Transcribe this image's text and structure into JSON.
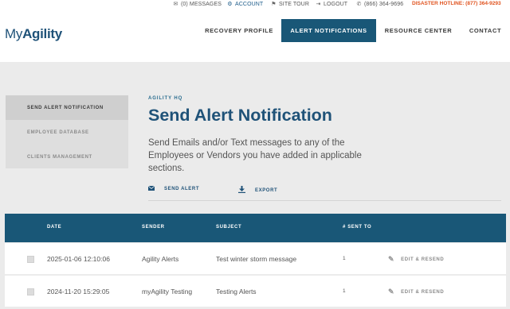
{
  "utility_bar": {
    "messages": "(0) MESSAGES",
    "account": "ACCOUNT",
    "site_tour": "SITE TOUR",
    "logout": "LOGOUT",
    "phone": "(866) 364-9696",
    "hotline": "DISASTER HOTLINE: (877) 364-9293"
  },
  "brand": {
    "logo_my": "My",
    "logo_agility": "Agility"
  },
  "nav": {
    "items": [
      {
        "label": "RECOVERY PROFILE"
      },
      {
        "label": "ALERT NOTIFICATIONS"
      },
      {
        "label": "RESOURCE CENTER"
      },
      {
        "label": "CONTACT"
      }
    ]
  },
  "sidebar": {
    "items": [
      {
        "label": "SEND ALERT NOTIFICATION"
      },
      {
        "label": "EMPLOYEE DATABASE"
      },
      {
        "label": "CLIENTS MANAGEMENT"
      }
    ]
  },
  "main": {
    "eyebrow": "AGILITY HQ",
    "title": "Send Alert Notification",
    "description": "Send Emails and/or Text messages to any of the Employees or Vendors you have added in applicable sections.",
    "actions": {
      "send_alert": "SEND ALERT",
      "export": "EXPORT"
    }
  },
  "table": {
    "headers": {
      "date": "DATE",
      "sender": "SENDER",
      "subject": "SUBJECT",
      "sent": "# SENT TO"
    },
    "rows": [
      {
        "date": "2025-01-06 12:10:06",
        "sender": "Agility Alerts",
        "subject": "Test winter storm message",
        "sent": "1",
        "action": "EDIT & RESEND"
      },
      {
        "date": "2024-11-20 15:29:05",
        "sender": "myAgility Testing",
        "subject": "Testing Alerts",
        "sent": "1",
        "action": "EDIT & RESEND"
      }
    ]
  },
  "colors": {
    "brand_blue": "#195777",
    "title_blue": "#1f5278",
    "hotline_orange": "#e0531f",
    "page_bg": "#ebebeb"
  }
}
